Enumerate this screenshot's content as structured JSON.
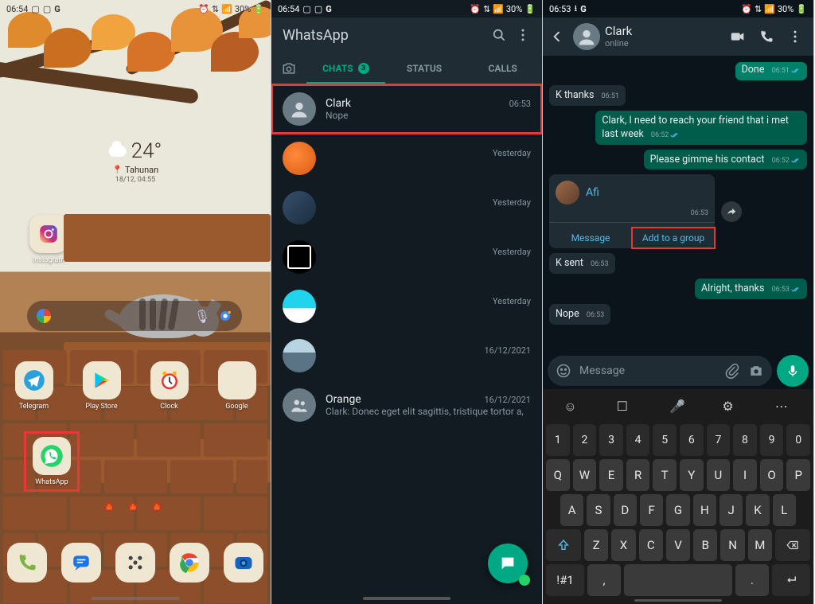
{
  "panel1": {
    "status": {
      "time": "06:54",
      "icons_left": [
        "image",
        "image",
        "G"
      ],
      "battery": "30%",
      "icons_right": [
        "alarm",
        "data",
        "wifi"
      ]
    },
    "weather": {
      "temp": "24°",
      "location": "Tahunan",
      "date": "18/12, 04:55"
    },
    "apps": {
      "instagram": "Instagram",
      "row": [
        {
          "label": "Telegram"
        },
        {
          "label": "Play Store"
        },
        {
          "label": "Clock"
        },
        {
          "label": "Google"
        }
      ],
      "whatsapp": "WhatsApp"
    },
    "decoration": "✦ ✦ ✦"
  },
  "panel2": {
    "status": {
      "time": "06:54",
      "battery": "30%"
    },
    "title": "WhatsApp",
    "tabs": {
      "chats": "CHATS",
      "status": "STATUS",
      "calls": "CALLS",
      "badge": "3"
    },
    "chats": [
      {
        "name": "Clark",
        "preview": "Nope",
        "time": "06:53",
        "avatar": "person",
        "highlight": true
      },
      {
        "name": "",
        "preview": "",
        "time": "Yesterday",
        "avatar": "orange"
      },
      {
        "name": "",
        "preview": "",
        "time": "Yesterday",
        "avatar": "photo1"
      },
      {
        "name": "",
        "preview": "",
        "time": "Yesterday",
        "avatar": "square"
      },
      {
        "name": "",
        "preview": "",
        "time": "Yesterday",
        "avatar": "photo2"
      },
      {
        "name": "",
        "preview": "",
        "time": "16/12/2021",
        "avatar": "photo3"
      },
      {
        "name": "Orange",
        "preview": "Clark: Donec eget elit sagittis, tristique tortor a,",
        "time": "16/12/2021",
        "avatar": "group"
      }
    ]
  },
  "panel3": {
    "status": {
      "time": "06:53",
      "battery": "30%"
    },
    "header": {
      "name": "Clark",
      "presence": "online"
    },
    "messages": {
      "done": {
        "text": "Done",
        "time": "06:51"
      },
      "kthanks": {
        "text": "K thanks",
        "time": "06:51"
      },
      "reach": {
        "text": "Clark, I need to reach your friend that i met last week",
        "time": "06:52"
      },
      "gimme": {
        "text": "Please gimme his contact",
        "time": "06:52"
      },
      "contact": {
        "name": "Afi",
        "time": "06:53",
        "msg_btn": "Message",
        "add_btn": "Add to a group"
      },
      "ksent": {
        "text": "K sent",
        "time": "06:53"
      },
      "alright": {
        "text": "Alright, thanks",
        "time": "06:53"
      },
      "nope": {
        "text": "Nope",
        "time": "06:53"
      }
    },
    "input": {
      "placeholder": "Message"
    },
    "keyboard": {
      "numbers": [
        "1",
        "2",
        "3",
        "4",
        "5",
        "6",
        "7",
        "8",
        "9",
        "0"
      ],
      "r1": [
        "Q",
        "W",
        "E",
        "R",
        "T",
        "Y",
        "U",
        "I",
        "O",
        "P"
      ],
      "r2": [
        "A",
        "S",
        "D",
        "F",
        "G",
        "H",
        "J",
        "K",
        "L"
      ],
      "r3": [
        "Z",
        "X",
        "C",
        "V",
        "B",
        "N",
        "M"
      ],
      "sym": "!#1",
      "comma": ",",
      "period": "."
    }
  }
}
